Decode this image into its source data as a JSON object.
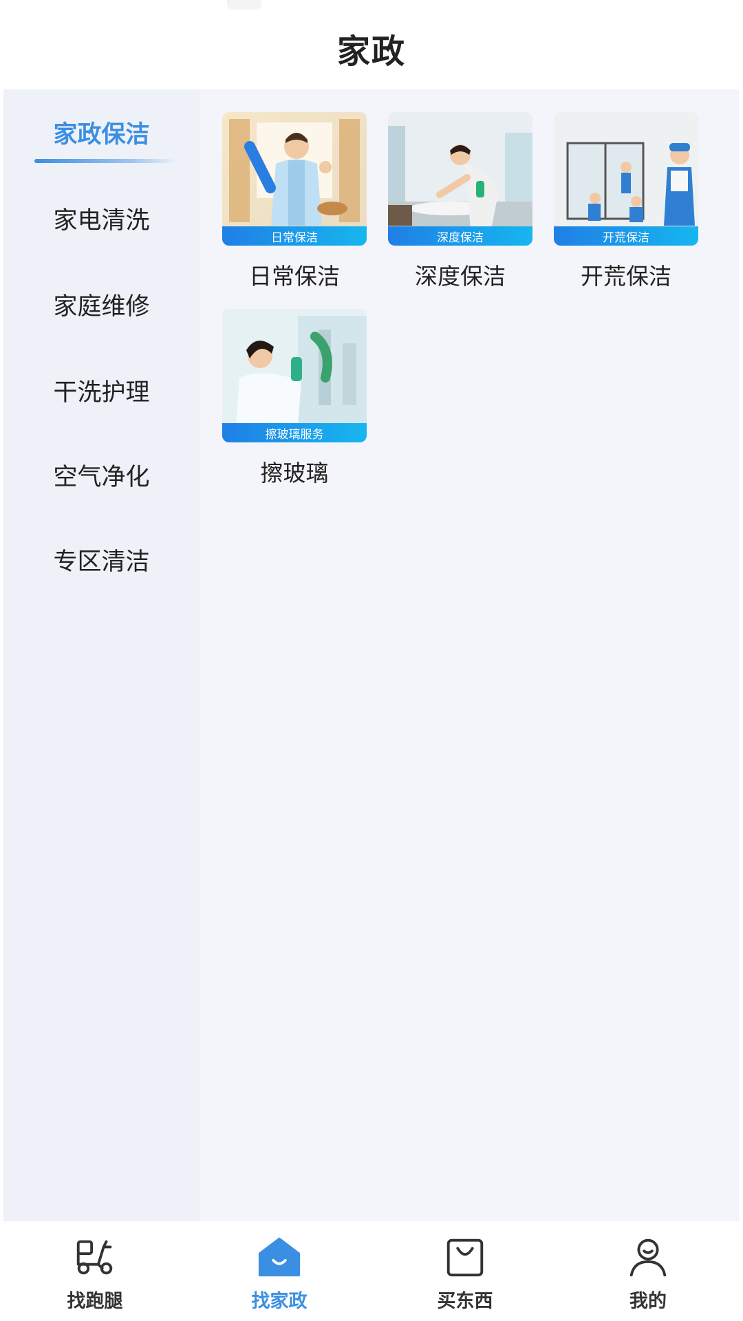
{
  "header": {
    "title": "家政"
  },
  "sidebar": {
    "items": [
      {
        "label": "家政保洁",
        "active": true
      },
      {
        "label": "家电清洗",
        "active": false
      },
      {
        "label": "家庭维修",
        "active": false
      },
      {
        "label": "干洗护理",
        "active": false
      },
      {
        "label": "空气净化",
        "active": false
      },
      {
        "label": "专区清洁",
        "active": false
      }
    ]
  },
  "services": [
    {
      "label": "日常保洁",
      "tag": "日常保洁"
    },
    {
      "label": "深度保洁",
      "tag": "深度保洁"
    },
    {
      "label": "开荒保洁",
      "tag": "开荒保洁"
    },
    {
      "label": "擦玻璃",
      "tag": "擦玻璃服务"
    }
  ],
  "bottom_nav": {
    "items": [
      {
        "label": "找跑腿",
        "icon": "scooter-icon",
        "active": false
      },
      {
        "label": "找家政",
        "icon": "home-icon",
        "active": true
      },
      {
        "label": "买东西",
        "icon": "shopping-bag-icon",
        "active": false
      },
      {
        "label": "我的",
        "icon": "user-icon",
        "active": false
      }
    ]
  },
  "colors": {
    "accent": "#3b8fe2",
    "sidebar_bg": "#eef1f8",
    "content_bg": "#f4f5fa",
    "tag_start": "#1f7fe6",
    "tag_end": "#17b6ef"
  }
}
